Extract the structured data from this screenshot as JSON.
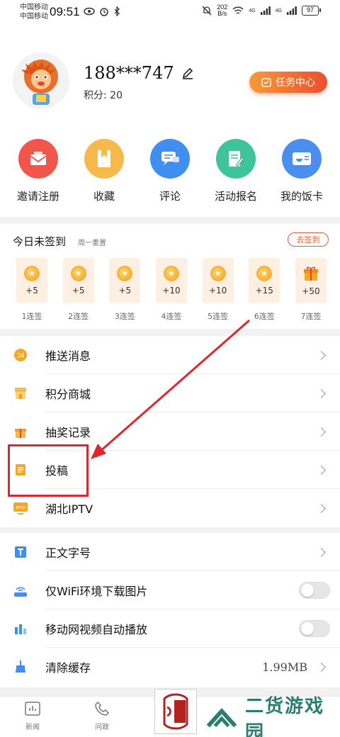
{
  "status_bar": {
    "carrier1": "中国移动",
    "carrier2": "中国移动",
    "time": "09:51",
    "net_speed_value": "202",
    "net_speed_unit": "B/s",
    "signal1": "4G",
    "signal2": "4G",
    "battery": "97"
  },
  "profile": {
    "username": "188***747",
    "points_label": "积分: 20",
    "task_button": "任务中心"
  },
  "quick_actions": [
    {
      "label": "邀请注册",
      "icon": "envelope-icon",
      "color": "#f0574a"
    },
    {
      "label": "收藏",
      "icon": "bookmark-icon",
      "color": "#f6b94b"
    },
    {
      "label": "评论",
      "icon": "chat-icon",
      "color": "#3f8ef0"
    },
    {
      "label": "活动报名",
      "icon": "signup-form-icon",
      "color": "#3fc49a"
    },
    {
      "label": "我的饭卡",
      "icon": "meal-card-icon",
      "color": "#4a8ff0"
    }
  ],
  "signin": {
    "title": "今日未签到",
    "subtitle": "周一重置",
    "button": "去签到",
    "days": [
      {
        "points": "+5",
        "label": "1连签"
      },
      {
        "points": "+5",
        "label": "2连签"
      },
      {
        "points": "+5",
        "label": "3连签"
      },
      {
        "points": "+10",
        "label": "4连签"
      },
      {
        "points": "+10",
        "label": "5连签"
      },
      {
        "points": "+15",
        "label": "6连签"
      },
      {
        "points": "+50",
        "label": "7连签"
      }
    ]
  },
  "menu1": [
    {
      "label": "推送消息",
      "icon": "push-24-icon"
    },
    {
      "label": "积分商城",
      "icon": "shop-icon"
    },
    {
      "label": "抽奖记录",
      "icon": "gift-icon"
    },
    {
      "label": "投稿",
      "icon": "document-icon"
    },
    {
      "label": "湖北IPTV",
      "icon": "tv-icon"
    }
  ],
  "menu2": [
    {
      "label": "正文字号",
      "icon": "font-size-icon"
    },
    {
      "label": "仅WiFi环境下载图片",
      "icon": "wifi-router-icon"
    },
    {
      "label": "移动网视频自动播放",
      "icon": "video-bars-icon"
    },
    {
      "label": "清除缓存",
      "icon": "broom-icon",
      "value": "1.99MB"
    }
  ],
  "tabbar": {
    "tab1": "新闻",
    "tab2": "问政"
  },
  "watermark": "二货游戏园",
  "colors": {
    "accent": "#e85a2e",
    "annotation_red": "#e0262c"
  }
}
